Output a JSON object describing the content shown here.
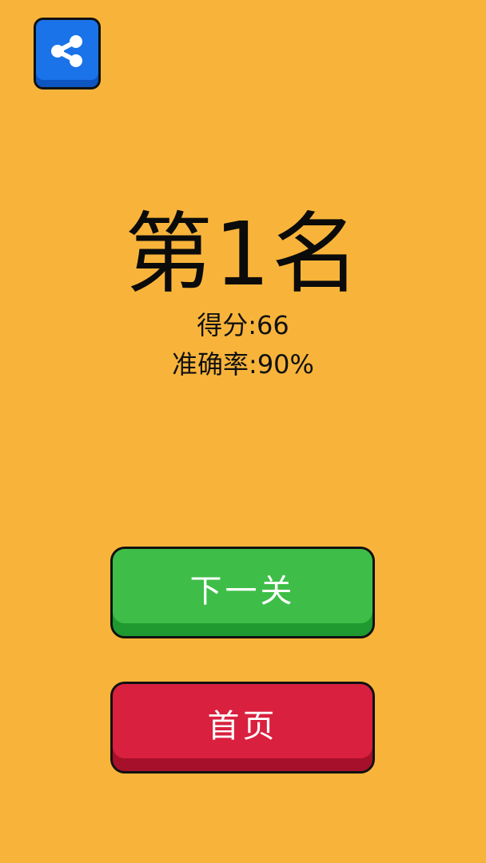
{
  "share": {
    "icon": "share-icon"
  },
  "result": {
    "rank_label": "第1名",
    "score_label": "得分:66",
    "accuracy_label": "准确率:90%"
  },
  "buttons": {
    "next_label": "下一关",
    "home_label": "首页"
  },
  "colors": {
    "background": "#F8B43A",
    "share_button": "#1A73E8",
    "next_button": "#3EBE48",
    "home_button": "#D9203F"
  }
}
